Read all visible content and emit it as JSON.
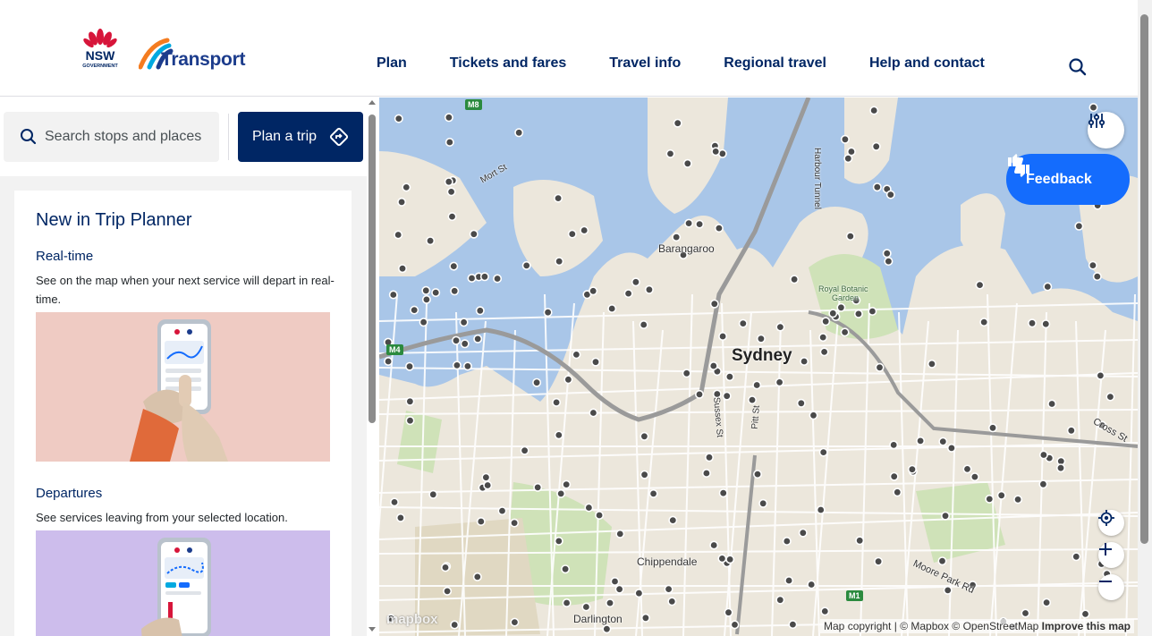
{
  "header": {
    "nsw_logo_text": "NSW",
    "nsw_logo_subtext": "GOVERNMENT",
    "brand_name": "Transport",
    "nav": [
      {
        "label": "Plan"
      },
      {
        "label": "Tickets and fares"
      },
      {
        "label": "Travel info"
      },
      {
        "label": "Regional travel"
      },
      {
        "label": "Help and contact"
      }
    ]
  },
  "sidebar": {
    "search_placeholder": "Search stops and places",
    "plan_button": "Plan a trip",
    "card": {
      "title": "New in Trip Planner",
      "sections": [
        {
          "title": "Real-time",
          "description": "See on the map when your next service will depart in real-time."
        },
        {
          "title": "Departures",
          "description": "See services leaving from your selected location."
        }
      ]
    }
  },
  "map": {
    "feedback_label": "Feedback",
    "labels": {
      "sydney": "Sydney",
      "barangaroo": "Barangaroo",
      "chippendale": "Chippendale",
      "darlington": "Darlington",
      "royal_botanic_1": "Royal Botanic",
      "royal_botanic_2": "Garden",
      "mort_st": "Mort St",
      "harbour_tunnel": "Harbour Tunnel",
      "sussex_st": "Sussex St",
      "pitt_st": "Pitt St",
      "cross_st": "Cross St",
      "moore_park_rd": "Moore Park Rd"
    },
    "road_badges": {
      "m8": "M8",
      "m4": "M4",
      "m1": "M1"
    },
    "attribution": {
      "copyright": "Map copyright",
      "mapbox": "© Mapbox",
      "osm": "© OpenStreetMap",
      "improve": "Improve this map"
    },
    "mapbox_logo": "mapbox",
    "colors": {
      "water": "#a9c6e8",
      "land": "#ece7dc",
      "park": "#cfe2b8",
      "stop": "#4a4a4a"
    }
  },
  "colors": {
    "brand_navy": "#002664",
    "feedback_blue": "#146cfd"
  }
}
